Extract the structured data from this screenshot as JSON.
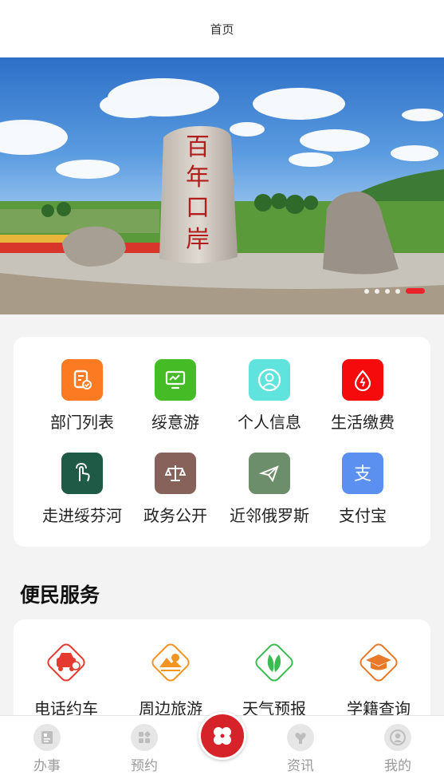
{
  "header": {
    "title": "首页"
  },
  "banner": {
    "stone_text": "百年口岸",
    "slide_count": 5,
    "active_slide": 5
  },
  "grid": {
    "items": [
      {
        "label": "部门列表",
        "icon": "document-check-icon",
        "color": "#fb7a22"
      },
      {
        "label": "绥意游",
        "icon": "monitor-chart-icon",
        "color": "#45bb26"
      },
      {
        "label": "个人信息",
        "icon": "user-circle-icon",
        "color": "#5fe3dc"
      },
      {
        "label": "生活缴费",
        "icon": "water-drop-icon",
        "color": "#f50b0b"
      },
      {
        "label": "走进绥芬河",
        "icon": "hand-pointer-icon",
        "color": "#1f5a47"
      },
      {
        "label": "政务公开",
        "icon": "balance-scale-icon",
        "color": "#87625a"
      },
      {
        "label": "近邻俄罗斯",
        "icon": "paper-plane-icon",
        "color": "#6d8e6a"
      },
      {
        "label": "支付宝",
        "icon": "alipay-icon",
        "color": "#5b8ff0"
      }
    ]
  },
  "services": {
    "title": "便民服务",
    "items": [
      {
        "label": "电话约车",
        "icon": "taxi-icon",
        "color": "#e53a30"
      },
      {
        "label": "周边旅游",
        "icon": "mountain-sun-icon",
        "color": "#f29422"
      },
      {
        "label": "天气预报",
        "icon": "leaf-icon",
        "color": "#3dbb53"
      },
      {
        "label": "学籍查询",
        "icon": "graduation-cap-icon",
        "color": "#e8792a"
      }
    ]
  },
  "tabbar": {
    "items": [
      {
        "label": "办事",
        "icon": "id-card-icon"
      },
      {
        "label": "预约",
        "icon": "apps-icon"
      },
      {
        "label": "资讯",
        "icon": "heart-hand-icon"
      },
      {
        "label": "我的",
        "icon": "profile-icon"
      }
    ],
    "center_icon": "clover-icon",
    "accent": "#d6232a"
  }
}
